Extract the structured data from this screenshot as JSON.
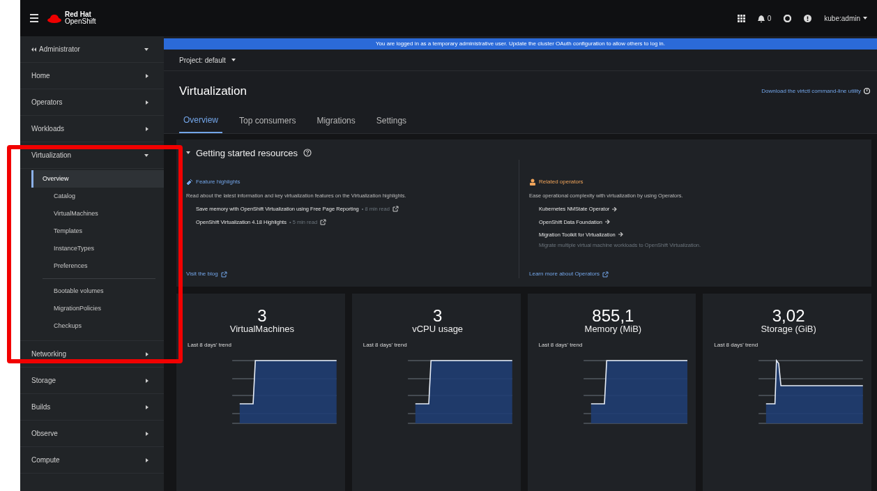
{
  "masthead": {
    "brand_top": "Red Hat",
    "brand_bottom": "OpenShift",
    "notifications": "0",
    "user": "kube:admin"
  },
  "sidebar": {
    "perspective": "Administrator",
    "items": [
      {
        "label": "Home",
        "expanded": false
      },
      {
        "label": "Operators",
        "expanded": false
      },
      {
        "label": "Workloads",
        "expanded": false
      },
      {
        "label": "Virtualization",
        "expanded": true,
        "children": [
          {
            "label": "Overview",
            "selected": true
          },
          {
            "label": "Catalog",
            "selected": false
          },
          {
            "label": "VirtualMachines",
            "selected": false
          },
          {
            "label": "Templates",
            "selected": false
          },
          {
            "label": "InstanceTypes",
            "selected": false
          },
          {
            "label": "Preferences",
            "selected": false
          },
          {
            "label": "Bootable volumes",
            "selected": false,
            "separator_before": true
          },
          {
            "label": "MigrationPolicies",
            "selected": false
          },
          {
            "label": "Checkups",
            "selected": false
          }
        ]
      },
      {
        "label": "Networking",
        "expanded": false
      },
      {
        "label": "Storage",
        "expanded": false
      },
      {
        "label": "Builds",
        "expanded": false
      },
      {
        "label": "Observe",
        "expanded": false
      },
      {
        "label": "Compute",
        "expanded": false
      }
    ]
  },
  "banner": {
    "before": "You are logged in as a temporary administrative user. Update the",
    "link": "cluster OAuth configuration",
    "after": "to allow others to log in."
  },
  "project": "Project: default",
  "page": {
    "title": "Virtualization",
    "download_link": "Download the virtctl command-line utility"
  },
  "tabs": [
    {
      "label": "Overview",
      "selected": true
    },
    {
      "label": "Top consumers",
      "selected": false
    },
    {
      "label": "Migrations",
      "selected": false
    },
    {
      "label": "Settings",
      "selected": false
    }
  ],
  "getting_started": {
    "title": "Getting started resources",
    "expanded": true,
    "feature": {
      "title": "Feature highlights",
      "description": "Read about the latest information and key virtualization features on the Virtualization highlights.",
      "links": [
        {
          "label": "Save memory with OpenShift Virtualization using Free Page Reporting",
          "meta": "• 8 min read"
        },
        {
          "label": "OpenShift Virtualization 4.18 Highlights",
          "meta": "• 5 min read"
        }
      ],
      "footer": "Visit the blog"
    },
    "operators": {
      "title": "Related operators",
      "description": "Ease operational complexity with virtualization by using Operators.",
      "links": [
        {
          "label": "Kubernetes NMState Operator"
        },
        {
          "label": "OpenShift Data Foundation"
        },
        {
          "label": "Migration Toolkit for Virtualization",
          "detail": "Migrate multiple virtual machine workloads to OpenShift Virtualization."
        }
      ],
      "footer": "Learn more about Operators"
    }
  },
  "metrics": [
    {
      "value": "3",
      "label": "VirtualMachines",
      "trend_label": "Last 8 days' trend",
      "kind": "step"
    },
    {
      "value": "3",
      "label": "vCPU usage",
      "trend_label": "Last 8 days' trend",
      "kind": "step"
    },
    {
      "value": "855,1",
      "label": "Memory (MiB)",
      "trend_label": "Last 8 days' trend",
      "kind": "step"
    },
    {
      "value": "3,02",
      "label": "Storage (GiB)",
      "trend_label": "Last 8 days' trend",
      "kind": "peak"
    }
  ]
}
